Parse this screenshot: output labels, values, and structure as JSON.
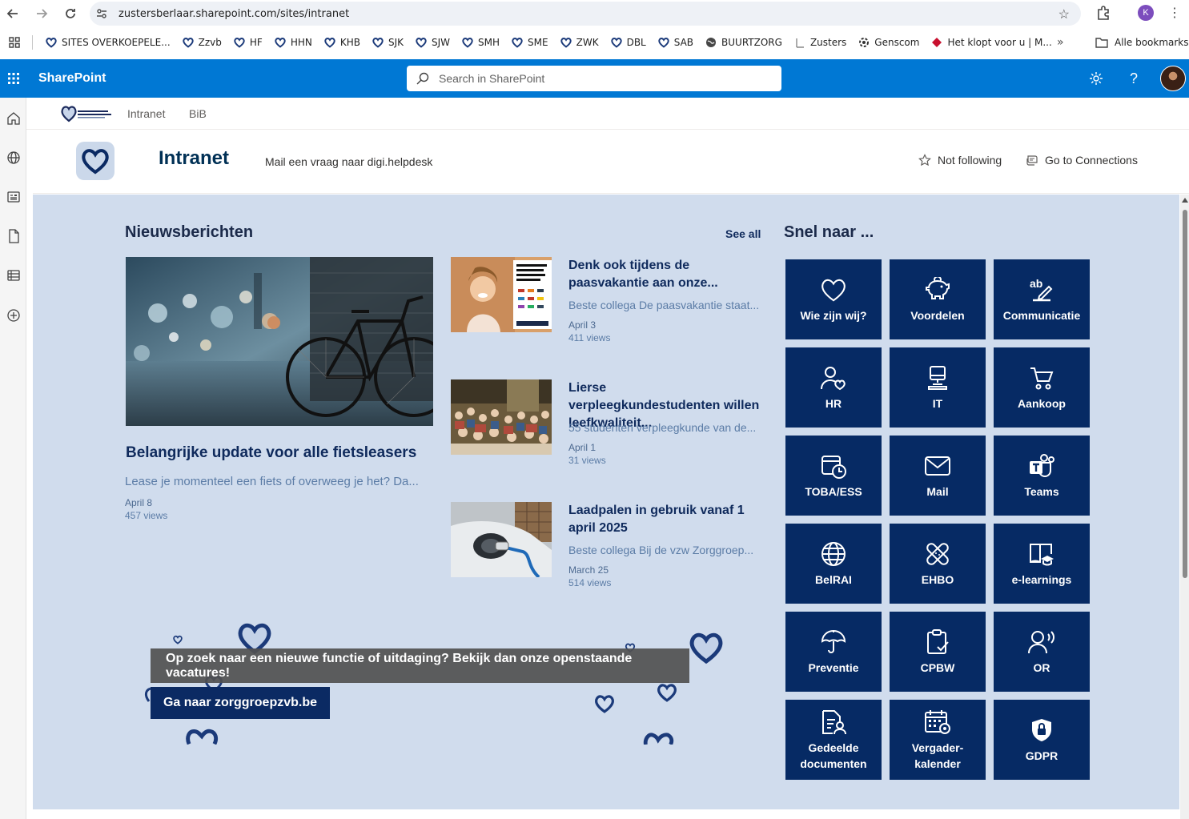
{
  "browser": {
    "url": "zustersberlaar.sharepoint.com/sites/intranet",
    "profile_initial": "K",
    "bookmarks": [
      {
        "label": "SITES OVERKOEPELE...",
        "icon": "heart-logo-icon"
      },
      {
        "label": "Zzvb",
        "icon": "heart-logo-icon"
      },
      {
        "label": "HF",
        "icon": "heart-logo-icon"
      },
      {
        "label": "HHN",
        "icon": "heart-logo-icon"
      },
      {
        "label": "KHB",
        "icon": "heart-logo-icon"
      },
      {
        "label": "SJK",
        "icon": "heart-logo-icon"
      },
      {
        "label": "SJW",
        "icon": "heart-logo-icon"
      },
      {
        "label": "SMH",
        "icon": "heart-logo-icon"
      },
      {
        "label": "SME",
        "icon": "heart-logo-icon"
      },
      {
        "label": "ZWK",
        "icon": "heart-logo-icon"
      },
      {
        "label": "DBL",
        "icon": "heart-logo-icon"
      },
      {
        "label": "SAB",
        "icon": "heart-logo-icon"
      },
      {
        "label": "BUURTZORG",
        "icon": "globe-icon"
      },
      {
        "label": "Zusters",
        "icon": "zusters-icon"
      },
      {
        "label": "Genscom",
        "icon": "genscom-icon"
      },
      {
        "label": "Het klopt voor u | M...",
        "icon": "diamond-icon"
      }
    ],
    "more_bookmarks": "»",
    "all_bookmarks": "Alle bookmarks"
  },
  "suitebar": {
    "title": "SharePoint",
    "search_placeholder": "Search in SharePoint"
  },
  "hubnav": {
    "logo_text": "ZORGGROEP ZUSTERS VAN BERLAAR",
    "links": [
      "Intranet",
      "BiB"
    ]
  },
  "site": {
    "title": "Intranet",
    "description": "Mail een vraag naar digi.helpdesk",
    "follow_label": "Not following",
    "connections_label": "Go to Connections"
  },
  "news": {
    "heading": "Nieuwsberichten",
    "see_all": "See all",
    "hero": {
      "title": "Belangrijke update voor alle fietsleasers",
      "description": "Lease je momenteel een fiets of overweeg je het? Da...",
      "date": "April 8",
      "views": "457 views"
    },
    "items": [
      {
        "title": "Denk ook tijdens de paasvakantie aan onze...",
        "description": "Beste collega De paasvakantie staat...",
        "date": "April 3",
        "views": "411 views",
        "thumb": "korting-promo"
      },
      {
        "title": "Lierse verpleegkundestudenten willen leefkwaliteit...",
        "description": "55 studenten verpleegkunde van de...",
        "date": "April 1",
        "views": "31 views",
        "thumb": "students-room"
      },
      {
        "title": "Laadpalen in gebruik vanaf 1 april 2025",
        "description": "Beste collega Bij de vzw Zorggroep...",
        "date": "March 25",
        "views": "514 views",
        "thumb": "ev-charger"
      }
    ]
  },
  "banner": {
    "text": "Op zoek naar een nieuwe functie of uitdaging? Bekijk dan onze openstaande vacatures!",
    "button": "Ga naar zorggroepzvb.be"
  },
  "quicklinks": {
    "heading": "Snel naar ...",
    "tiles": [
      {
        "label": "Wie zijn wij?",
        "icon": "heart-icon"
      },
      {
        "label": "Voordelen",
        "icon": "piggy-bank-icon"
      },
      {
        "label": "Communicatie",
        "icon": "text-edit-icon"
      },
      {
        "label": "HR",
        "icon": "person-heart-icon"
      },
      {
        "label": "IT",
        "icon": "desktop-icon"
      },
      {
        "label": "Aankoop",
        "icon": "cart-icon"
      },
      {
        "label": "TOBA/ESS",
        "icon": "calendar-clock-icon"
      },
      {
        "label": "Mail",
        "icon": "mail-icon"
      },
      {
        "label": "Teams",
        "icon": "teams-icon"
      },
      {
        "label": "BelRAI",
        "icon": "globe-icon"
      },
      {
        "label": "EHBO",
        "icon": "bandage-icon"
      },
      {
        "label": "e-learnings",
        "icon": "book-grad-icon"
      },
      {
        "label": "Preventie",
        "icon": "umbrella-icon"
      },
      {
        "label": "CPBW",
        "icon": "clipboard-check-icon"
      },
      {
        "label": "OR",
        "icon": "person-voice-icon"
      },
      {
        "label": "Gedeelde documenten",
        "icon": "document-person-icon"
      },
      {
        "label": "Vergader-kalender",
        "icon": "calendar-gear-icon"
      },
      {
        "label": "GDPR",
        "icon": "shield-lock-icon"
      }
    ]
  },
  "colors": {
    "suitebar": "#0078d4",
    "canvas": "#d0dced",
    "tile": "#062a64",
    "banner_button": "#0b2a63"
  }
}
